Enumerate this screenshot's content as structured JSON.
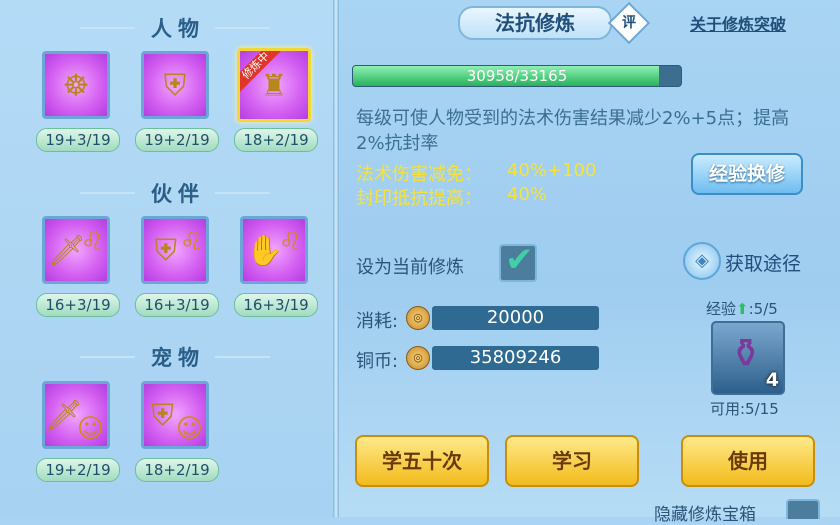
{
  "title": "法抗修炼",
  "rate_badge": "评",
  "breakthrough_link": "关于修炼突破",
  "sections": {
    "character": "人物",
    "partner": "伙伴",
    "pet": "宠物"
  },
  "character_slots": [
    {
      "level": "19+3/19",
      "selected": false,
      "badge": ""
    },
    {
      "level": "19+2/19",
      "selected": false,
      "badge": ""
    },
    {
      "level": "18+2/19",
      "selected": true,
      "badge": "修炼中"
    }
  ],
  "partner_slots": [
    {
      "level": "16+3/19"
    },
    {
      "level": "16+3/19"
    },
    {
      "level": "16+3/19"
    }
  ],
  "pet_slots": [
    {
      "level": "19+2/19"
    },
    {
      "level": "18+2/19"
    }
  ],
  "progress": {
    "text": "30958/33165",
    "current": 30958,
    "max": 33165
  },
  "description": "每级可使人物受到的法术伤害结果减少2%+5点；提高2%抗封率",
  "stats": [
    {
      "label": "法术伤害减免：",
      "value": "40%+100"
    },
    {
      "label": "封印抵抗提高：",
      "value": "40%"
    }
  ],
  "exp_exchange_button": "经验换修",
  "set_current_label": "设为当前修炼",
  "set_current_checked": true,
  "get_way_label": "获取途径",
  "cost_label": "消耗:",
  "cost_value": "20000",
  "copper_label": "铜币:",
  "copper_value": "35809246",
  "exp_label": "经验",
  "exp_value": ":5/5",
  "item_count": "4",
  "available_label": "可用:5/15",
  "buttons": {
    "learn50": "学五十次",
    "learn": "学习",
    "use": "使用"
  },
  "hide_label": "隐藏修炼宝箱",
  "colors": {
    "accent_gold": "#f2bb1c",
    "progress_green": "#27b25c",
    "stat_yellow": "#f5e23a"
  }
}
